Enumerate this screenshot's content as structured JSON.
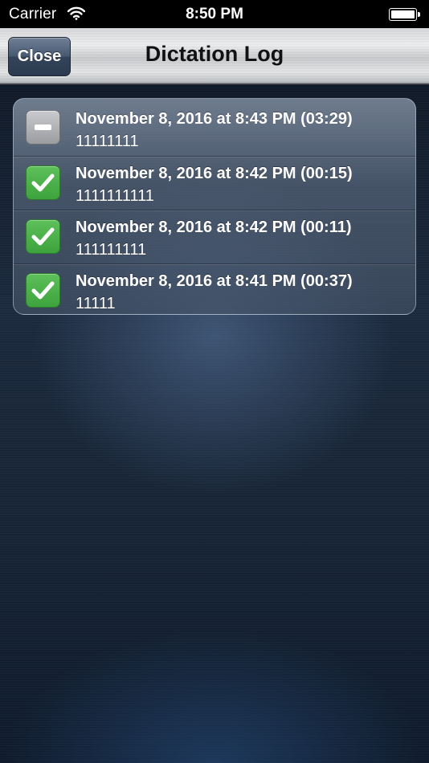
{
  "status_bar": {
    "carrier": "Carrier",
    "time": "8:50 PM",
    "wifi_icon": "wifi-icon",
    "battery_icon": "battery-full-icon"
  },
  "nav_bar": {
    "title": "Dictation Log",
    "close_label": "Close"
  },
  "log": {
    "entries": [
      {
        "title": "November 8, 2016 at 8:43 PM (03:29)",
        "text": "11111111",
        "checked": false,
        "icon": "minus-icon"
      },
      {
        "title": "November 8, 2016 at 8:42 PM (00:15)",
        "text": "1111111111",
        "checked": true,
        "icon": "checkmark-icon"
      },
      {
        "title": "November 8, 2016 at 8:42 PM (00:11)",
        "text": "111111111",
        "checked": true,
        "icon": "checkmark-icon"
      },
      {
        "title": "November 8, 2016 at 8:41 PM (00:37)",
        "text": "11111",
        "checked": true,
        "icon": "checkmark-icon"
      }
    ]
  },
  "colors": {
    "checked_green": "#4cb14a",
    "unchecked_gray": "#b3b5b8",
    "nav_button_blue": "#485a72"
  }
}
